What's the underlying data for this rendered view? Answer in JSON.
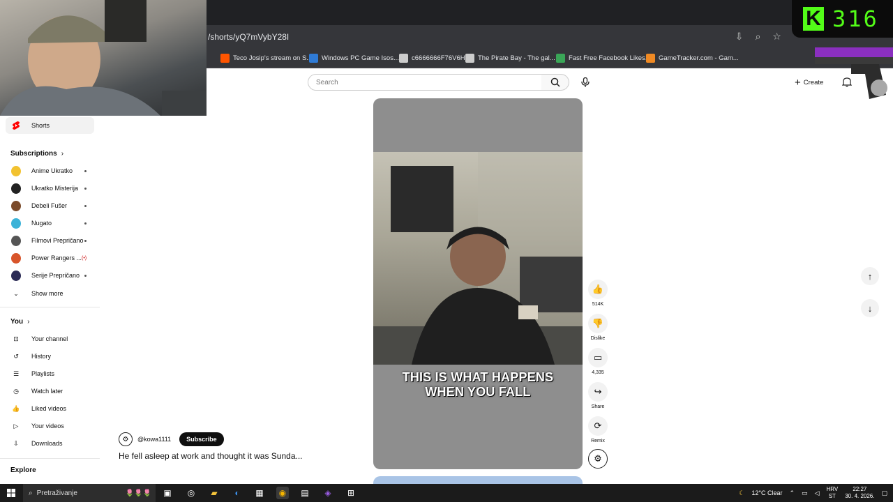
{
  "browser": {
    "url": "/shorts/yQ7mVybY28I",
    "bookmarks": [
      {
        "label": "Teco Josip's stream on S...",
        "color": "#ff5500"
      },
      {
        "label": "Windows PC Game Isos...",
        "color": "#2f7bd6"
      },
      {
        "label": "c6666666F76V6H",
        "color": "#cccccc"
      },
      {
        "label": "The Pirate Bay - The gal...",
        "color": "#cccccc"
      },
      {
        "label": "Fast Free Facebook Likes...",
        "color": "#3aa657"
      },
      {
        "label": "GameTracker.com - Gam...",
        "color": "#f08a24"
      }
    ]
  },
  "overlay": {
    "kick_letter": "K",
    "kick_count": "316"
  },
  "header": {
    "search_placeholder": "Search",
    "create_label": "Create"
  },
  "sidebar": {
    "shorts_label": "Shorts",
    "subscriptions_title": "Subscriptions",
    "subscriptions": [
      {
        "label": "Anime Ukratko",
        "color": "#f2c230",
        "indicator": "dot"
      },
      {
        "label": "Ukratko Misterija",
        "color": "#222222",
        "indicator": "dot"
      },
      {
        "label": "Debeli Fušer",
        "color": "#7a4a2a",
        "indicator": "dot"
      },
      {
        "label": "Nugato",
        "color": "#3cb3d8",
        "indicator": "dot"
      },
      {
        "label": "Filmovi Prepričano",
        "color": "#555555",
        "indicator": "dot"
      },
      {
        "label": "Power Rangers ...",
        "color": "#d8552b",
        "indicator": "(•)"
      },
      {
        "label": "Serije Prepričano",
        "color": "#2b2b55",
        "indicator": "dot"
      }
    ],
    "show_more": "Show more",
    "you_title": "You",
    "you_items": [
      {
        "label": "Your channel",
        "icon": "channel-icon"
      },
      {
        "label": "History",
        "icon": "history-icon"
      },
      {
        "label": "Playlists",
        "icon": "playlists-icon"
      },
      {
        "label": "Watch later",
        "icon": "watch-later-icon"
      },
      {
        "label": "Liked videos",
        "icon": "like-icon"
      },
      {
        "label": "Your videos",
        "icon": "your-videos-icon"
      },
      {
        "label": "Downloads",
        "icon": "download-icon"
      }
    ],
    "explore_title": "Explore"
  },
  "short": {
    "caption_line1": "THIS IS WHAT HAPPENS",
    "caption_line2": "WHEN YOU FALL",
    "channel": "@kowa1111",
    "subscribe": "Subscribe",
    "title": "He fell asleep at work and thought it was Sunda...",
    "actions": {
      "likes": "514K",
      "dislike": "Dislike",
      "comments": "4,335",
      "share": "Share",
      "remix": "Remix"
    }
  },
  "taskbar": {
    "search_placeholder": "Pretraživanje",
    "weather": "12°C  Clear",
    "lang_line1": "HRV",
    "lang_line2": "ST",
    "time": "22:27",
    "date": "30. 4. 2026."
  }
}
